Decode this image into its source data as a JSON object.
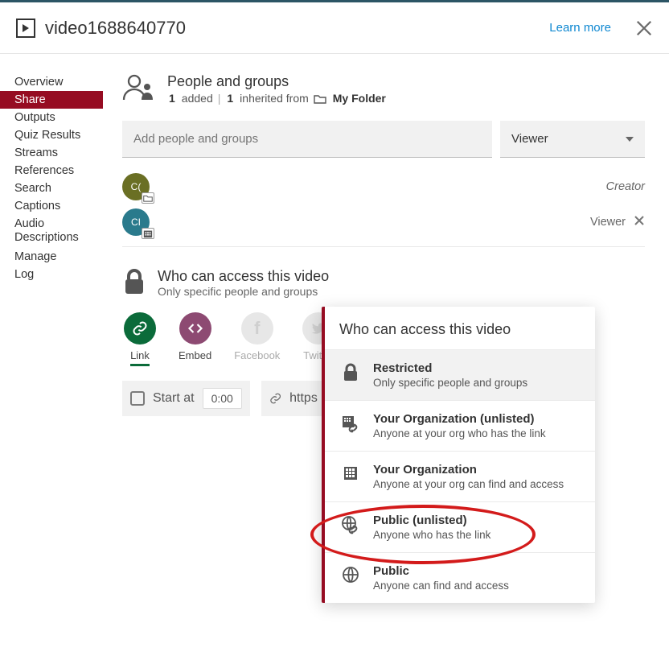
{
  "header": {
    "title": "video1688640770",
    "learn_more": "Learn more"
  },
  "sidebar": {
    "items": [
      "Overview",
      "Share",
      "Outputs",
      "Quiz Results",
      "Streams",
      "References",
      "Search",
      "Captions",
      "Audio Descriptions",
      "Manage",
      "Log"
    ],
    "active_index": 1
  },
  "people_groups": {
    "title": "People and groups",
    "added_count": "1",
    "added_label": "added",
    "inherited_count": "1",
    "inherited_label": "inherited from",
    "folder": "My Folder",
    "input_placeholder": "Add people and groups",
    "role_selected": "Viewer",
    "rows": [
      {
        "initials": "C(",
        "color": "olive",
        "badge": "folder",
        "role": "Creator",
        "italic": true,
        "removable": false
      },
      {
        "initials": "CI",
        "color": "teal",
        "badge": "building",
        "role": "Viewer",
        "italic": false,
        "removable": true
      }
    ]
  },
  "access": {
    "title": "Who can access this video",
    "subtitle": "Only specific people and groups"
  },
  "share_buttons": [
    {
      "key": "link",
      "label": "Link",
      "style": "green",
      "active": true
    },
    {
      "key": "embed",
      "label": "Embed",
      "style": "plum",
      "active": false
    },
    {
      "key": "facebook",
      "label": "Facebook",
      "style": "gray",
      "active": false
    },
    {
      "key": "twitter",
      "label": "Twitter",
      "style": "gray",
      "active": false
    }
  ],
  "link_bar": {
    "start_at_label": "Start at",
    "start_time": "0:00",
    "url_preview": "https"
  },
  "popup": {
    "title": "Who can access this video",
    "selected_index": 0,
    "options": [
      {
        "icon": "lock",
        "title": "Restricted",
        "sub": "Only specific people and groups"
      },
      {
        "icon": "org-link",
        "title": "Your Organization (unlisted)",
        "sub": "Anyone at your org who has the link"
      },
      {
        "icon": "org",
        "title": "Your Organization",
        "sub": "Anyone at your org can find and access"
      },
      {
        "icon": "globe-link",
        "title": "Public (unlisted)",
        "sub": "Anyone who has the link"
      },
      {
        "icon": "globe",
        "title": "Public",
        "sub": "Anyone can find and access"
      }
    ]
  }
}
